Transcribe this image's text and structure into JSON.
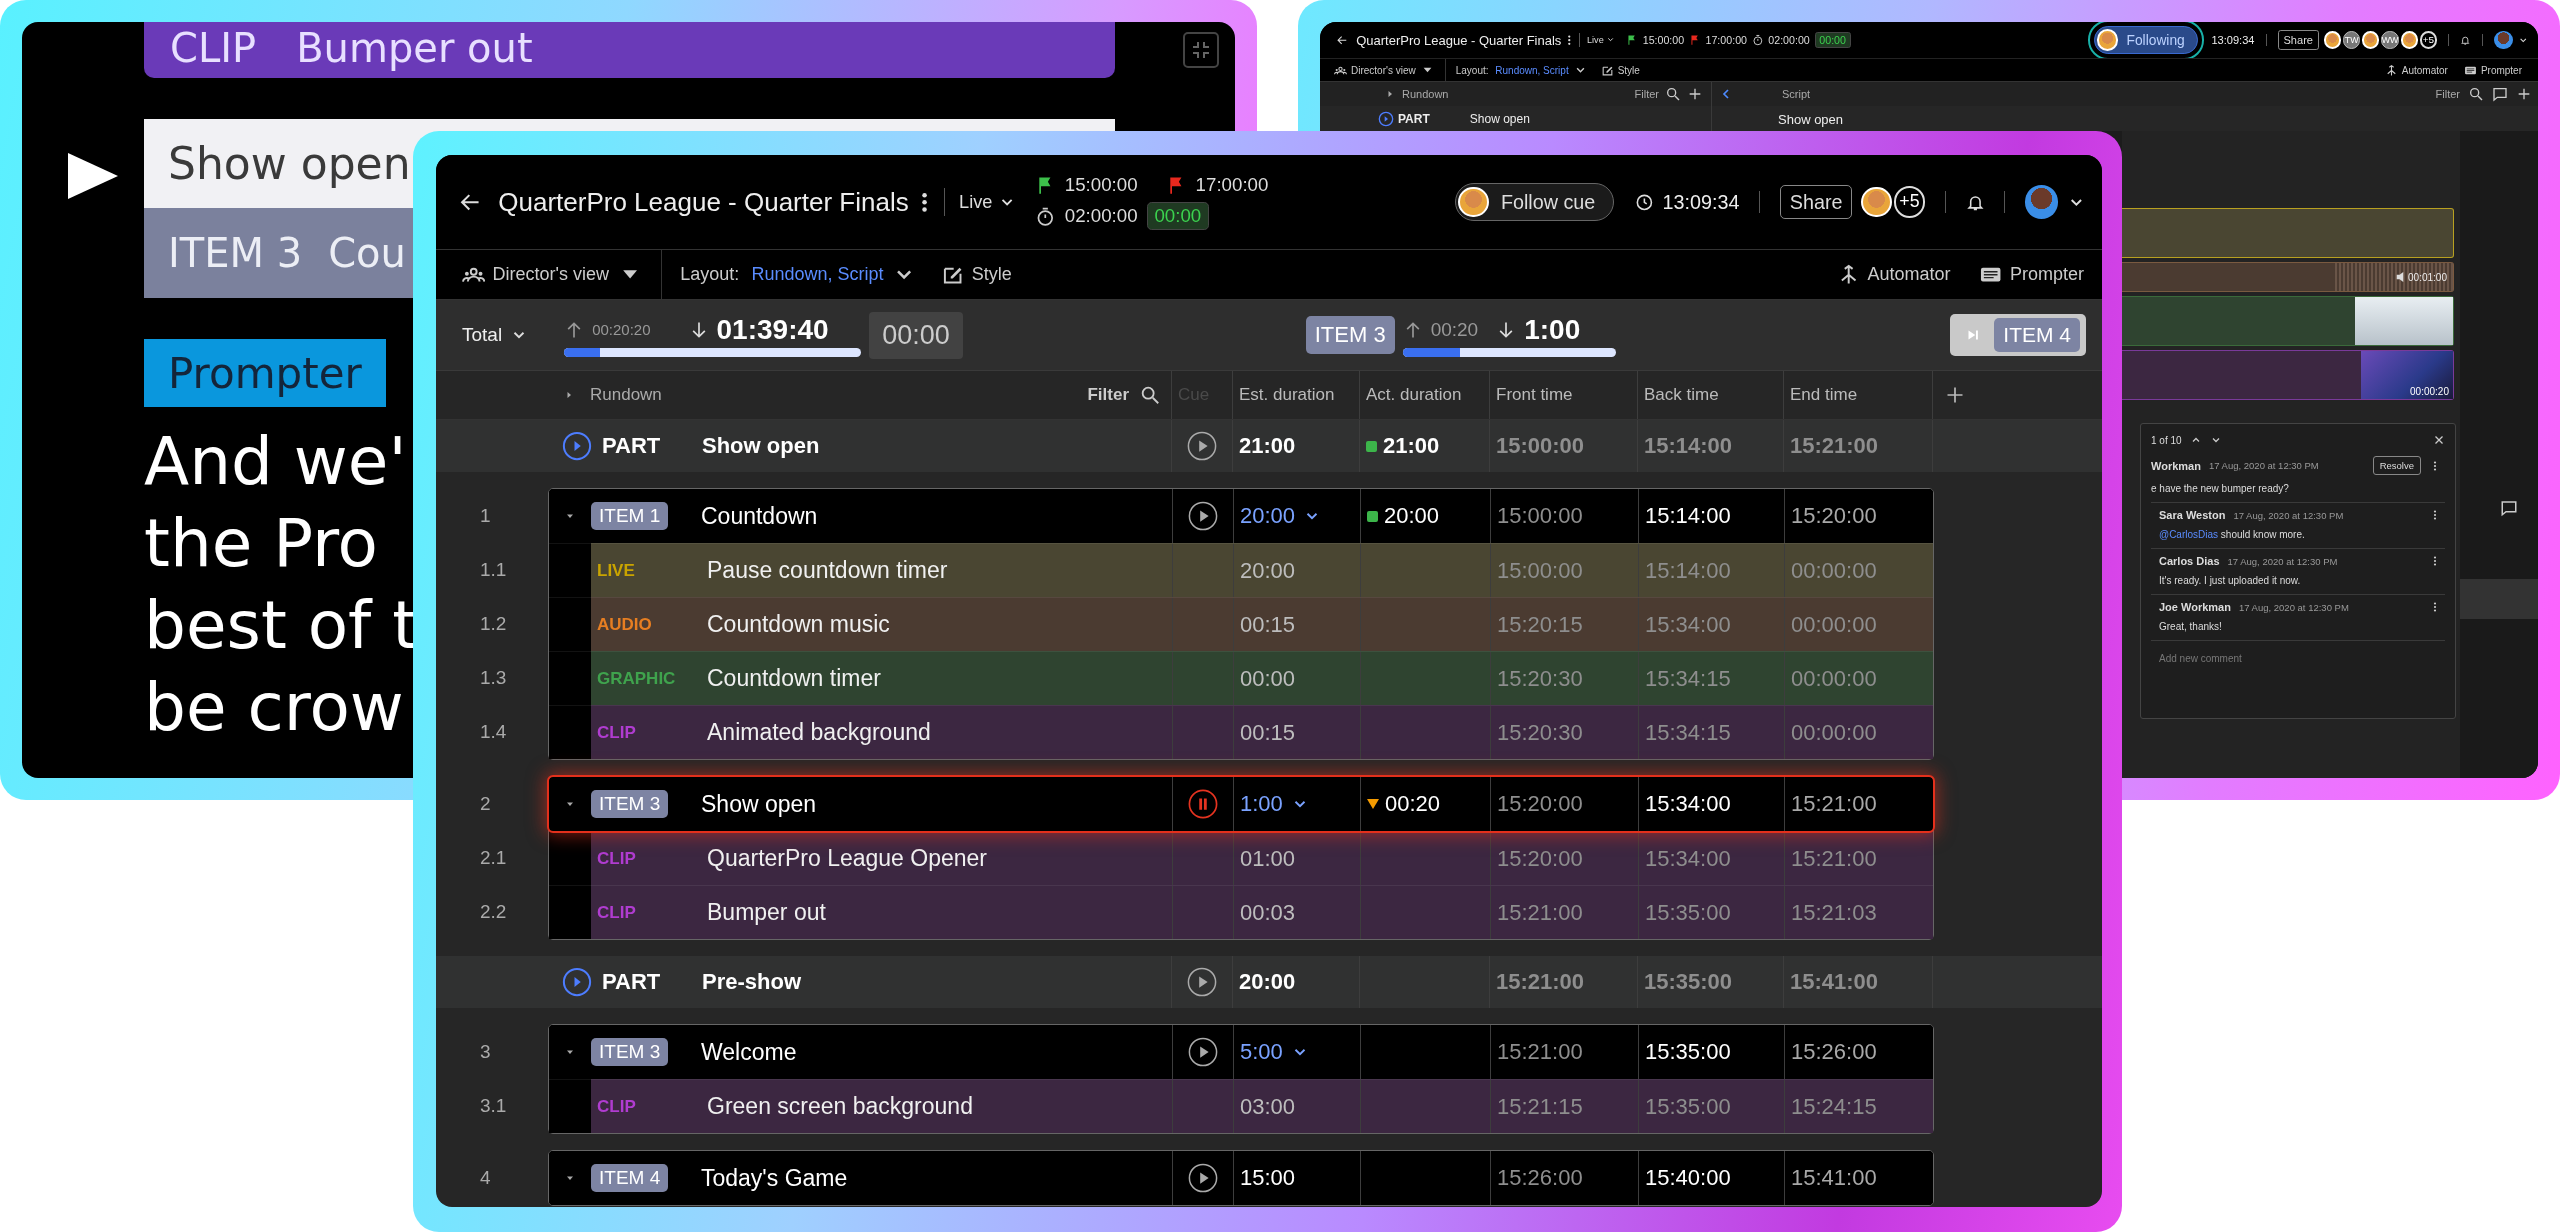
{
  "left_window": {
    "clip_bar": {
      "type": "CLIP",
      "title": "Bumper out"
    },
    "current_title": "Show open",
    "next": {
      "badge": "ITEM 3",
      "title": "Cou"
    },
    "prompter_label": "Prompter",
    "script_lines": [
      "And we'",
      "the Pro",
      "best of t",
      "be crow"
    ]
  },
  "right_window": {
    "title": "QuarterPro League - Quarter Finals",
    "status": "Live",
    "start_time": "15:00:00",
    "end_time": "17:00:00",
    "duration": "02:00:00",
    "elapsed": "00:00",
    "follow_button": "Following",
    "clock": "13:09:34",
    "share_button": "Share",
    "avatars": [
      {
        "kind": "photo"
      },
      {
        "kind": "initials",
        "initials": "TW"
      },
      {
        "kind": "photo"
      },
      {
        "kind": "initials",
        "initials": "WW"
      },
      {
        "kind": "photo"
      }
    ],
    "more_count": "+5",
    "toolbar": {
      "view": "Director's view",
      "layout_label": "Layout:",
      "layout_value": "Rundown, Script",
      "style": "Style",
      "automator": "Automator",
      "prompter": "Prompter"
    },
    "rundown_header": {
      "label": "Rundown",
      "filter": "Filter"
    },
    "script_header": {
      "label": "Script",
      "filter": "Filter"
    },
    "part_row": {
      "label": "PART",
      "title": "Show open"
    },
    "script_title": "Show open",
    "timeline": [
      {
        "kind": "live"
      },
      {
        "kind": "audio",
        "duration": "00:01:00"
      },
      {
        "kind": "graphic"
      },
      {
        "kind": "clip",
        "duration": "00:00:20"
      }
    ],
    "comments": {
      "counter": "1 of 10",
      "resolve_button": "Resolve",
      "placeholder": "Add new comment",
      "items": [
        {
          "author": "Workman",
          "time": "17 Aug, 2020 at 12:30 PM",
          "text": "e have the new bumper ready?"
        },
        {
          "author": "Sara Weston",
          "time": "17 Aug, 2020 at 12:30 PM",
          "mention": "@CarlosDias",
          "text": "should know more."
        },
        {
          "author": "Carlos Dias",
          "time": "17 Aug, 2020 at 12:30 PM",
          "text": "It's ready. I just uploaded it now."
        },
        {
          "author": "Joe Workman",
          "time": "17 Aug, 2020 at 12:30 PM",
          "text": "Great, thanks!"
        }
      ]
    }
  },
  "main_window": {
    "title": "QuarterPro League - Quarter Finals",
    "status": "Live",
    "start_time": "15:00:00",
    "end_time": "17:00:00",
    "duration": "02:00:00",
    "elapsed": "00:00",
    "follow_button": "Follow cue",
    "clock": "13:09:34",
    "share_button": "Share",
    "avatars": [
      {
        "kind": "photo"
      }
    ],
    "more_count": "+5",
    "toolbar": {
      "view": "Director's view",
      "layout_label": "Layout:",
      "layout_value": "Rundown, Script",
      "style": "Style",
      "automator": "Automator",
      "prompter": "Prompter"
    },
    "timers": {
      "total_label": "Total",
      "total_elapsed": "00:20:20",
      "total_remaining": "01:39:40",
      "total_progress": {
        "level": 0.12
      },
      "over_time": "00:00",
      "current_badge": "ITEM 3",
      "current_elapsed": "00:20",
      "current_remaining": "1:00",
      "current_progress": {
        "level": 0.27
      },
      "next_badge": "ITEM 4"
    },
    "columns": {
      "rundown": "Rundown",
      "filter": "Filter",
      "cue": "Cue",
      "est": "Est. duration",
      "act": "Act. duration",
      "front": "Front time",
      "back": "Back time",
      "end": "End time"
    },
    "rows": [
      {
        "kind": "part",
        "label": "PART",
        "title": "Show open",
        "playing": false,
        "est": "21:00",
        "act": "21:00",
        "late": false,
        "front": "15:00:00",
        "back": "15:14:00",
        "end": "15:21:00"
      },
      {
        "kind": "item",
        "number": "1",
        "badge": "ITEM 1",
        "title": "Countdown",
        "expanded": true,
        "on_air": false,
        "playing": false,
        "est": "20:00",
        "est_menu": true,
        "act": "20:00",
        "late": false,
        "front": "15:00:00",
        "back": "15:14:00",
        "end": "15:20:00",
        "children": [
          {
            "number": "1.1",
            "kind": "live",
            "type": "LIVE",
            "title": "Pause countdown timer",
            "est": "20:00",
            "front": "15:00:00",
            "back": "15:14:00",
            "end": "00:00:00"
          },
          {
            "number": "1.2",
            "kind": "audio",
            "type": "AUDIO",
            "title": "Countdown music",
            "est": "00:15",
            "front": "15:20:15",
            "back": "15:34:00",
            "end": "00:00:00"
          },
          {
            "number": "1.3",
            "kind": "graphic",
            "type": "GRAPHIC",
            "title": "Countdown timer",
            "est": "00:00",
            "front": "15:20:30",
            "back": "15:34:15",
            "end": "00:00:00"
          },
          {
            "number": "1.4",
            "kind": "clip",
            "type": "CLIP",
            "title": "Animated background",
            "est": "00:15",
            "front": "15:20:30",
            "back": "15:34:15",
            "end": "00:00:00"
          }
        ]
      },
      {
        "kind": "item",
        "number": "2",
        "badge": "ITEM 3",
        "title": "Show open",
        "expanded": true,
        "on_air": true,
        "playing": true,
        "est": "1:00",
        "est_menu": true,
        "act": "00:20",
        "late": true,
        "front": "15:20:00",
        "back": "15:34:00",
        "end": "15:21:00",
        "children": [
          {
            "number": "2.1",
            "kind": "clip",
            "type": "CLIP",
            "title": "QuarterPro League Opener",
            "est": "01:00",
            "front": "15:20:00",
            "back": "15:34:00",
            "end": "15:21:00"
          },
          {
            "number": "2.2",
            "kind": "clip",
            "type": "CLIP",
            "title": "Bumper out",
            "est": "00:03",
            "front": "15:21:00",
            "back": "15:35:00",
            "end": "15:21:03"
          }
        ]
      },
      {
        "kind": "part",
        "label": "PART",
        "title": "Pre-show",
        "playing": false,
        "est": "20:00",
        "front": "15:21:00",
        "back": "15:35:00",
        "end": "15:41:00"
      },
      {
        "kind": "item",
        "number": "3",
        "badge": "ITEM 3",
        "title": "Welcome",
        "expanded": true,
        "on_air": false,
        "playing": false,
        "est": "5:00",
        "est_menu": true,
        "front": "15:21:00",
        "back": "15:35:00",
        "end": "15:26:00",
        "children": [
          {
            "number": "3.1",
            "kind": "clip",
            "type": "CLIP",
            "title": "Green screen background",
            "est": "03:00",
            "front": "15:21:15",
            "back": "15:35:00",
            "end": "15:24:15"
          }
        ]
      },
      {
        "kind": "item",
        "number": "4",
        "badge": "ITEM 4",
        "title": "Today's Game",
        "expanded": true,
        "on_air": false,
        "playing": false,
        "est": "15:00",
        "est_menu": false,
        "front": "15:26:00",
        "back": "15:40:00",
        "end": "15:41:00",
        "children": []
      }
    ]
  }
}
